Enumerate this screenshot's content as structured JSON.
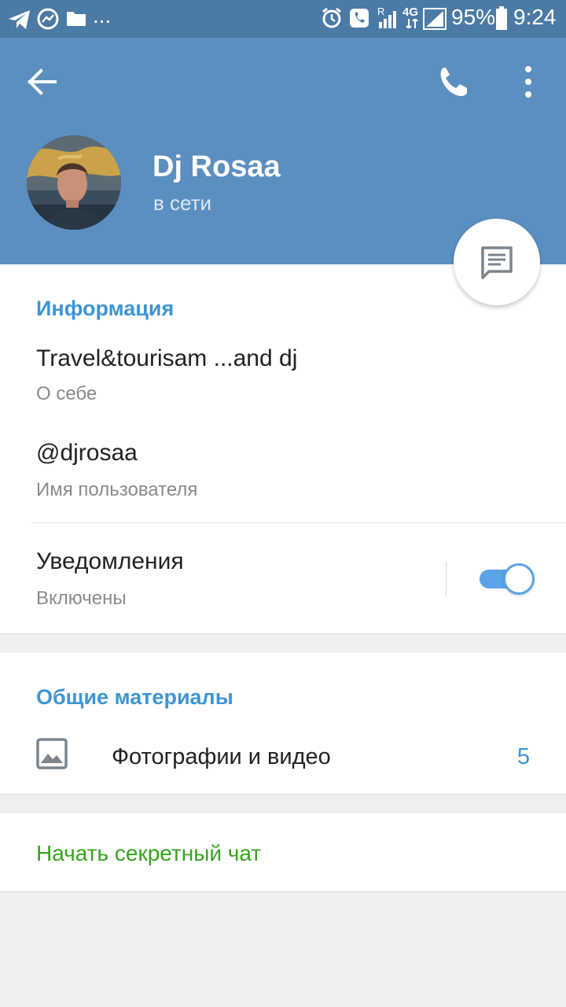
{
  "status_bar": {
    "battery": "95%",
    "time": "9:24",
    "overflow": "...",
    "network_4g": "4G",
    "roaming": "R",
    "icons": [
      "telegram-icon",
      "chart-icon",
      "folder-icon",
      "alarm-icon",
      "call-icon",
      "signal-icon",
      "battery-icon"
    ]
  },
  "header": {
    "name": "Dj Rosaa",
    "status": "в сети",
    "colors": {
      "background": "#5b8fc0",
      "status_bar": "#4b7aa5"
    }
  },
  "info": {
    "section_title": "Информация",
    "bio_value": "Travel&tourisam ...and dj",
    "bio_label": "О себе",
    "username_value": "@djrosaa",
    "username_label": "Имя пользователя",
    "notifications_value": "Уведомления",
    "notifications_label": "Включены",
    "notifications_enabled": true
  },
  "shared_media": {
    "section_title": "Общие материалы",
    "photos_label": "Фотографии и видео",
    "photos_count": "5"
  },
  "secret_chat": {
    "label": "Начать секретный чат",
    "color": "#37a31f"
  },
  "accent_color": "#3d95d6"
}
